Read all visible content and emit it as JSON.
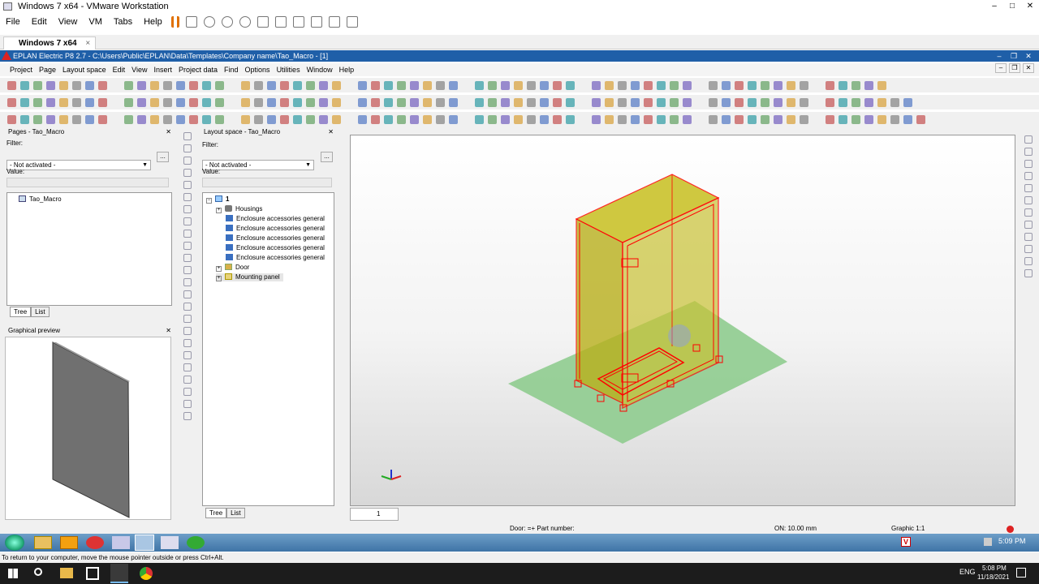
{
  "vmware": {
    "title": "Windows 7 x64 - VMware Workstation",
    "menu": [
      "File",
      "Edit",
      "View",
      "VM",
      "Tabs",
      "Help"
    ],
    "tab_label": "Windows 7 x64",
    "tab_close": "×",
    "window_controls": [
      "–",
      "□",
      "✕"
    ],
    "hint": "To return to your computer, move the mouse pointer outside or press Ctrl+Alt."
  },
  "eplan": {
    "title": "EPLAN Electric P8 2.7 - C:\\Users\\Public\\EPLAN\\Data\\Templates\\Company name\\Tao_Macro - [1]",
    "menu": [
      "Project",
      "Page",
      "Layout space",
      "Edit",
      "View",
      "Insert",
      "Project data",
      "Find",
      "Options",
      "Utilities",
      "Window",
      "Help"
    ],
    "window_controls": [
      "–",
      "❐",
      "✕"
    ]
  },
  "pages_panel": {
    "title": "Pages - Tao_Macro",
    "close": "✕",
    "filter_label": "Filter:",
    "filter_value": "- Not activated -",
    "more_button": "...",
    "value_label": "Value:",
    "tree_items": [
      "Tao_Macro"
    ],
    "tabs": [
      "Tree",
      "List"
    ]
  },
  "preview_panel": {
    "title": "Graphical preview",
    "close": "✕"
  },
  "layout_panel": {
    "title": "Layout space - Tao_Macro",
    "close": "✕",
    "filter_label": "Filter:",
    "filter_value": "- Not activated -",
    "more_button": "...",
    "value_label": "Value:",
    "root": "1",
    "items": [
      "Housings",
      "Enclosure accessories general",
      "Enclosure accessories general",
      "Enclosure accessories general",
      "Enclosure accessories general",
      "Enclosure accessories general",
      "Door",
      "Mounting panel"
    ],
    "tabs": [
      "Tree",
      "List"
    ]
  },
  "viewport": {
    "page_number": "1"
  },
  "status": {
    "door": "Door: =+ Part number:",
    "on": "ON: 10.00 mm",
    "graphic": "Graphic 1:1"
  },
  "win7_taskbar": {
    "clock": "5:09 PM"
  },
  "host_taskbar": {
    "lang": "ENG",
    "time": "5:08 PM",
    "date": "11/18/2021"
  },
  "colors": {
    "eplan_title": "#1f5fa8",
    "enclosure_fill": "#c8c020",
    "enclosure_edge": "#ff0000",
    "floor_plane": "#8fcc8f"
  }
}
